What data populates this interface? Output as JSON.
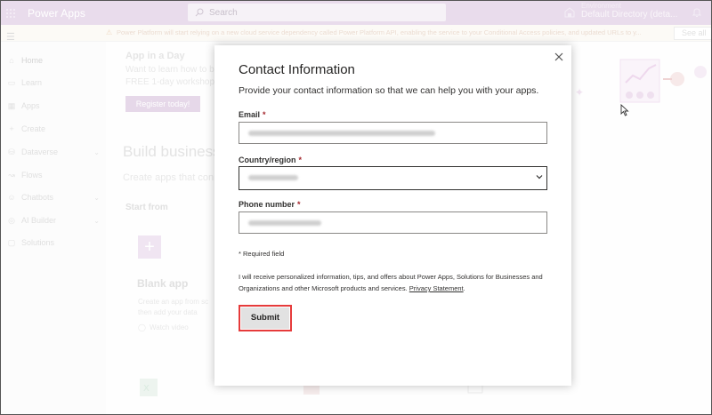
{
  "topbar": {
    "app_title": "Power Apps",
    "search_placeholder": "Search",
    "environment_label": "Environment",
    "environment_name": "Default Directory (deta..."
  },
  "banner": {
    "message": "Power Platform will start relying on a new cloud service dependency called Power Platform API, enabling the service to your Conditional Access policies, and updated URLs to y...",
    "see_all": "See all"
  },
  "sidebar": {
    "items": [
      {
        "label": "Home",
        "icon": "home-icon",
        "chevron": false
      },
      {
        "label": "Learn",
        "icon": "book-icon",
        "chevron": false
      },
      {
        "label": "Apps",
        "icon": "apps-icon",
        "chevron": false
      },
      {
        "label": "Create",
        "icon": "plus-icon",
        "chevron": false
      },
      {
        "label": "Dataverse",
        "icon": "database-icon",
        "chevron": true
      },
      {
        "label": "Flows",
        "icon": "flow-icon",
        "chevron": false
      },
      {
        "label": "Chatbots",
        "icon": "chatbot-icon",
        "chevron": true
      },
      {
        "label": "AI Builder",
        "icon": "ai-icon",
        "chevron": true
      },
      {
        "label": "Solutions",
        "icon": "solutions-icon",
        "chevron": false
      }
    ]
  },
  "main": {
    "promo_title": "App in a Day",
    "promo_line1": "Want to learn how to b",
    "promo_line2": "FREE 1-day workshop!",
    "register_label": "Register today!",
    "build_heading": "Build business",
    "build_sub": "Create apps that conn",
    "start_from": "Start from",
    "blank_app_title": "Blank app",
    "blank_app_desc1": "Create an app from sc",
    "blank_app_desc2": "then add your data",
    "watch_video": "Watch video"
  },
  "dialog": {
    "title": "Contact Information",
    "subtitle": "Provide your contact information so that we can help you with your apps.",
    "email_label": "Email",
    "country_label": "Country/region",
    "phone_label": "Phone number",
    "required_marker": "*",
    "required_note": "* Required field",
    "consent_text": "I will receive personalized information, tips, and offers about Power Apps, Solutions for Businesses and Organizations and other Microsoft products and services.",
    "privacy_link": "Privacy Statement",
    "submit_label": "Submit"
  },
  "colors": {
    "brand_bar": "#e9dcec",
    "highlight_border": "#e63b3b",
    "required": "#a4262c"
  }
}
